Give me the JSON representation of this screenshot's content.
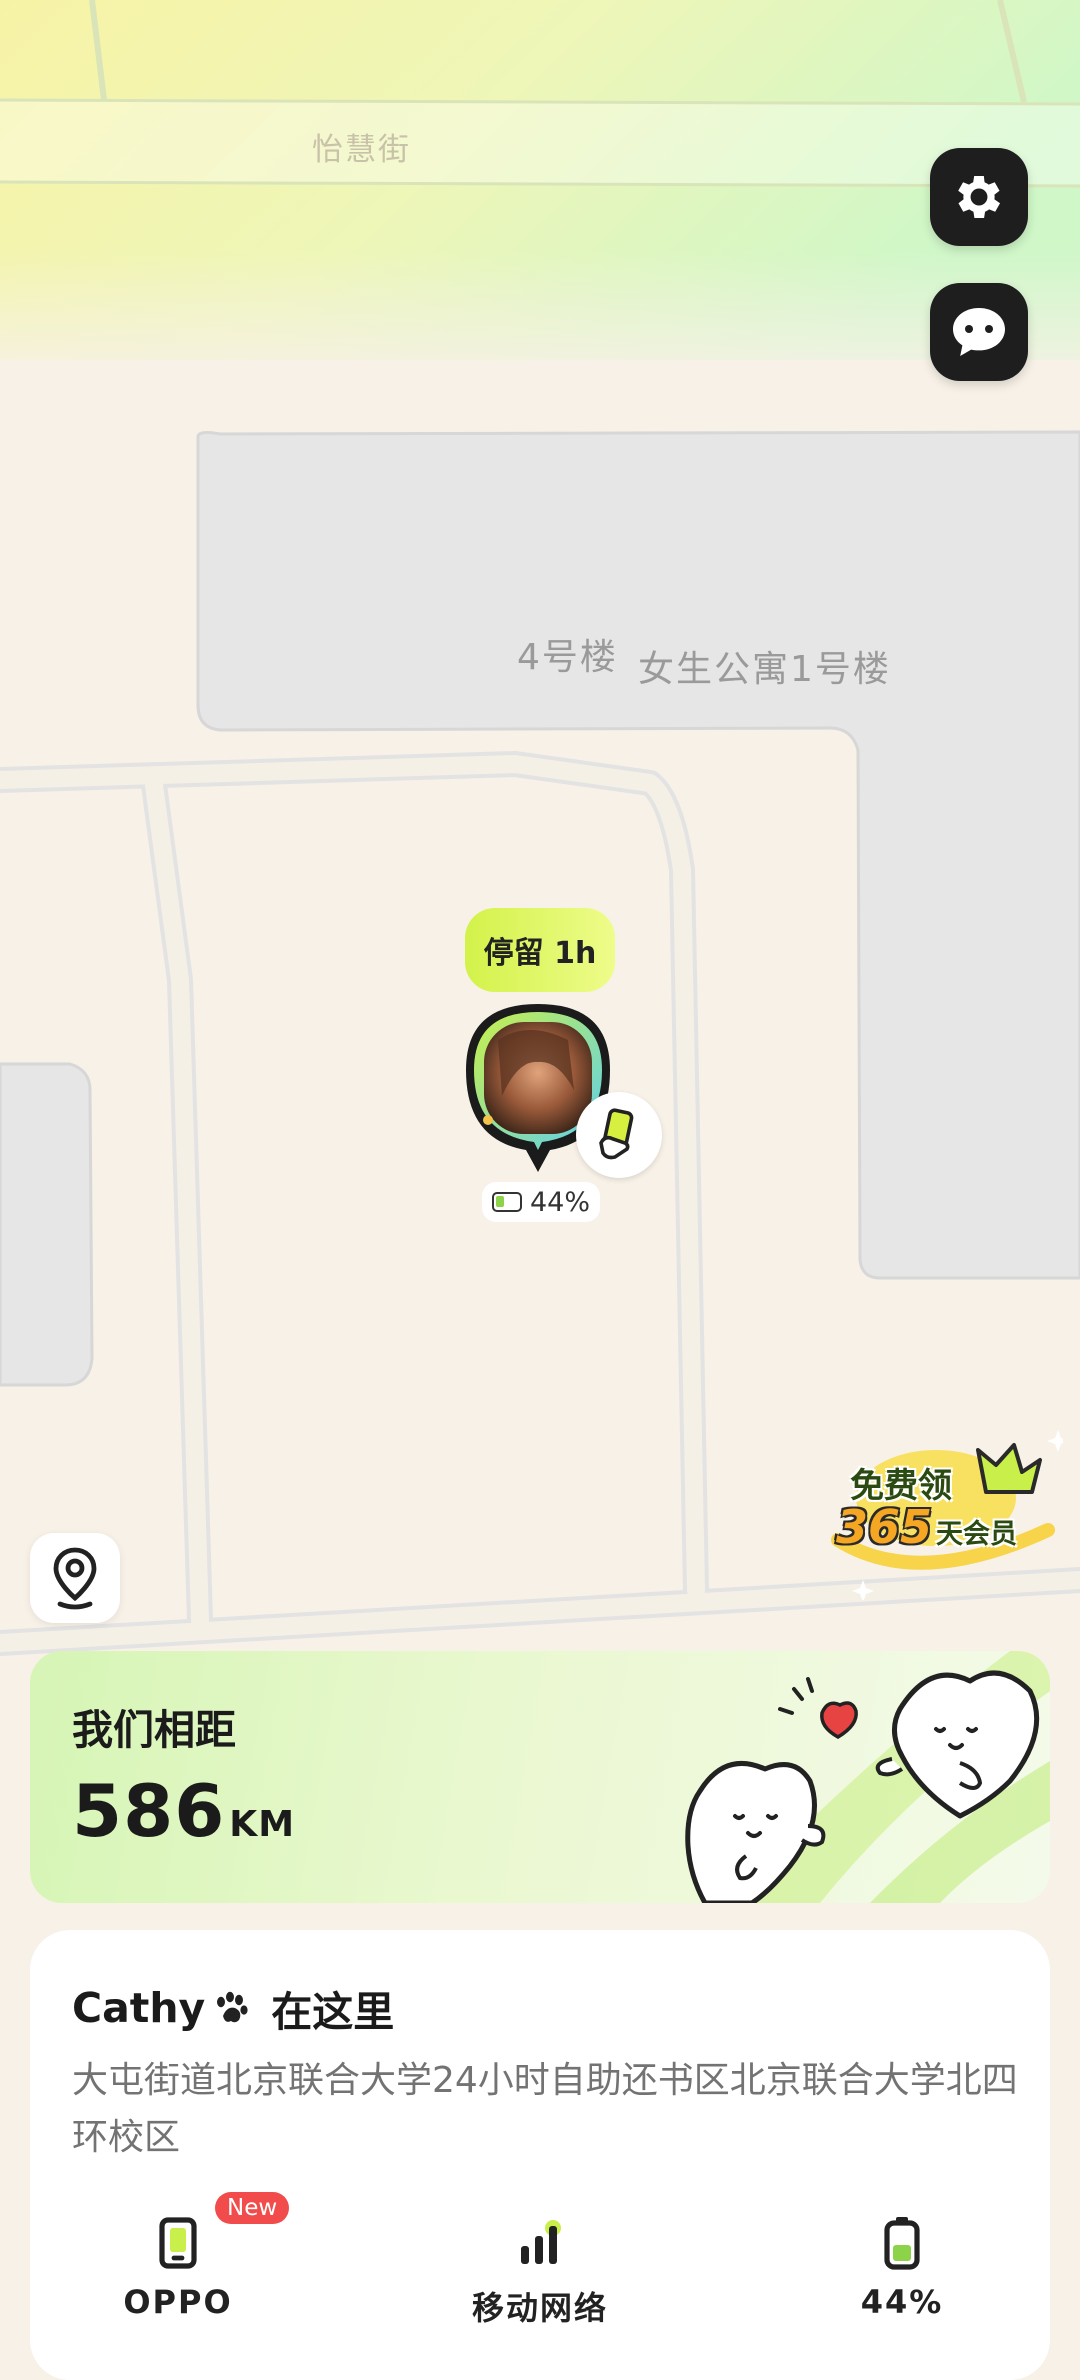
{
  "map": {
    "street_label": "怡慧街",
    "building_label_1": "4号楼",
    "building_label_2": "女生公寓1号楼"
  },
  "toolbar": {
    "settings_icon": "gear-icon",
    "chat_icon": "chat-bubble-icon",
    "locate_icon": "location-pin-icon"
  },
  "partner_marker": {
    "stay_text": "停留 1h",
    "battery_text": "44%",
    "device_icon": "phone-in-hand-icon"
  },
  "promo": {
    "line1": "免费领",
    "line2_number": "365",
    "line2_text": "天会员"
  },
  "distance_card": {
    "title": "我们相距",
    "value": "586",
    "unit": "KM"
  },
  "info_card": {
    "name": "Cathy",
    "name_suffix": "在这里",
    "address": "大屯街道北京联合大学24小时自助还书区北京联合大学北四环校区",
    "stats": [
      {
        "icon": "phone-icon",
        "label": "OPPO",
        "badge": "New"
      },
      {
        "icon": "signal-icon",
        "label": "移动网络"
      },
      {
        "icon": "battery-icon",
        "label": "44%"
      }
    ]
  },
  "colors": {
    "accent_green": "#c9ef4a",
    "card_green": "#d6f5b5",
    "dark_button": "#1e1e1e",
    "badge_red": "#f14b4b"
  }
}
